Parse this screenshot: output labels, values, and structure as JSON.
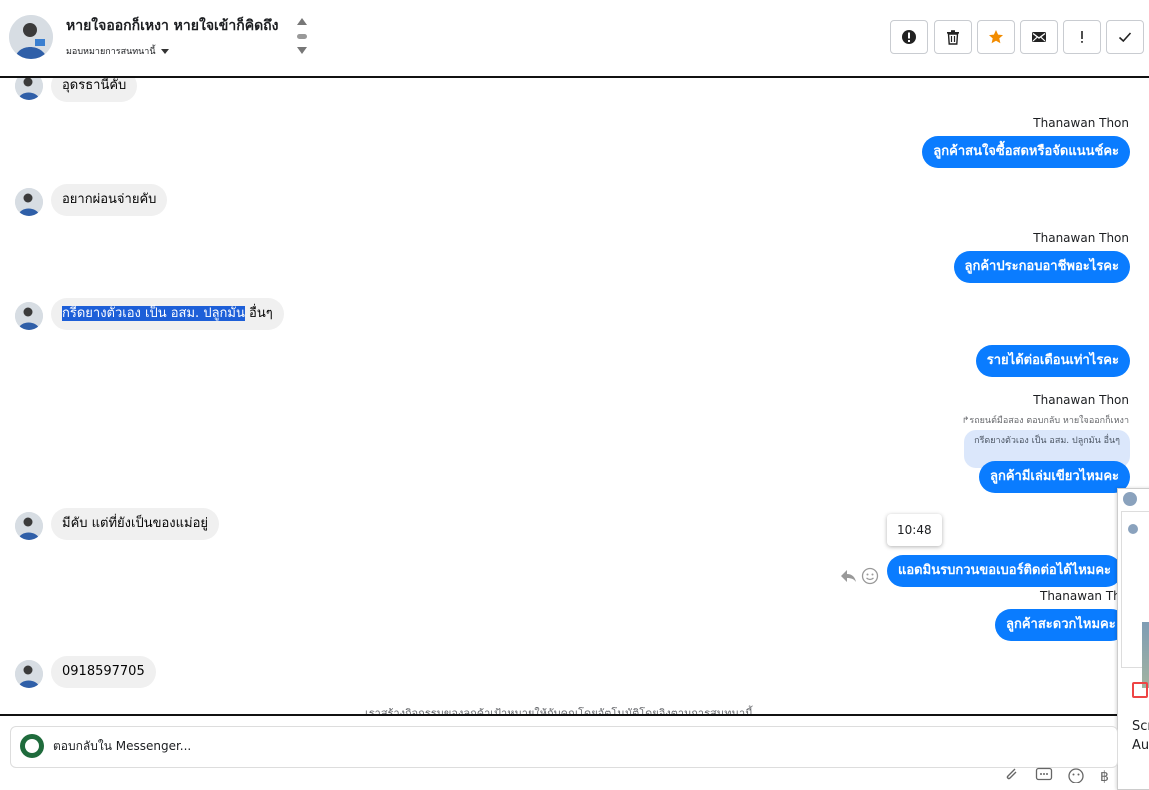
{
  "header": {
    "title": "หายใจออกก็เหงา หายใจเข้าก็คิดถึง",
    "assign_label": "มอบหมายการสนทนานี้",
    "toolbar": [
      "spam-report",
      "delete",
      "star",
      "mark-unread",
      "important",
      "done"
    ]
  },
  "messages": {
    "m1": "อุดรธานีคับ",
    "sender1": "Thanawan Thon",
    "m2": "ลูกค้าสนใจซื้อสดหรือจัดแนนช์คะ",
    "m3": "อยากผ่อนจ่ายคับ",
    "sender2": "Thanawan Thon",
    "m4": "ลูกค้าประกอบอาชีพอะไรคะ",
    "m5_highlight": "กรีดยางตัวเอง เป็น อสม. ปลูกมัน",
    "m5_rest": " อื่นๆ",
    "m6": "รายได้ต่อเดือนเท่าไรคะ",
    "sender3": "Thanawan Thon",
    "reply_meta": "รถยนต์มือสอง ตอบกลับ หายใจออกก็เหงา",
    "quote": "กรีดยางตัวเอง เป็น อสม. ปลูกมัน อื่นๆ",
    "m7": "ลูกค้ามีเล่มเขียวไหมคะ",
    "m8": "มีคับ แต่ที่ยังเป็นของแม่อยู่",
    "tooltip_time": "10:48",
    "m9": "แอดมินรบกวนขอเบอร์ติดต่อได้ไหมคะ",
    "sender4": "Thanawan Thon",
    "m10": "ลูกค้าสะดวกไหมคะ",
    "m11": "0918597705",
    "footer_note": "เราสร้างกิจกรรมของลูกค้าเป้าหมายให้กับคุณโดยอัตโนมัติโดยอิงตามการสนทนานี้"
  },
  "right_panel": {
    "line1": "Scr",
    "line2": "Au"
  },
  "composer": {
    "placeholder": "ตอบกลับใน Messenger..."
  },
  "colors": {
    "outgoing": "#0a7cff",
    "incoming": "#f0f0f0",
    "highlight": "#1d5fd8",
    "star": "#f28c00"
  }
}
